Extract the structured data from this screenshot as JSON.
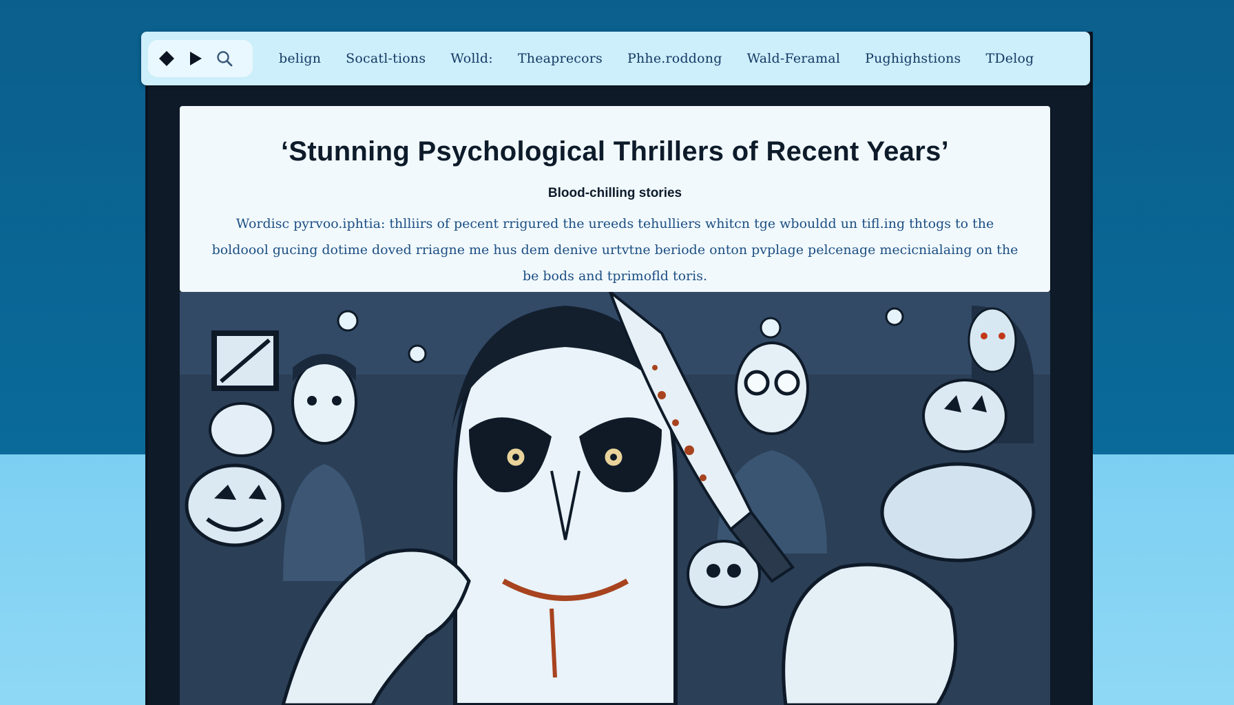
{
  "nav": {
    "links": [
      "belign",
      "Socatl-tions",
      "Wolld:",
      "Theaprecors",
      "Phhe.roddong",
      "Wald-Feramal",
      "Pughighstions",
      "TDelog"
    ]
  },
  "controls": {
    "icons": [
      "diamond-icon",
      "play-icon",
      "search-icon"
    ]
  },
  "article": {
    "title": "‘Stunning Psychological Thrillers of Recent Years’",
    "subtitle": "Blood-chilling stories",
    "body": "Wordisc pyrvoo.iphtia: thlliirs of pecent rrigured the ureeds tehulliers whitcn tge wbouldd un tifl.ing thtogs to the boldoool gucing dotime doved rriagne me hus dem denive urtvtne beriode onton pvplage pelcenage mecicnialaing on the be bods and tprimofld toris."
  },
  "colors": {
    "navbar": "#cdeefb",
    "nav_text": "#133a63",
    "title_text": "#0d1b2a",
    "body_text": "#1c4e82",
    "frame": "#0e1a28",
    "bg_top": "#0a6a9a",
    "bg_bottom": "#8fd8f5"
  }
}
